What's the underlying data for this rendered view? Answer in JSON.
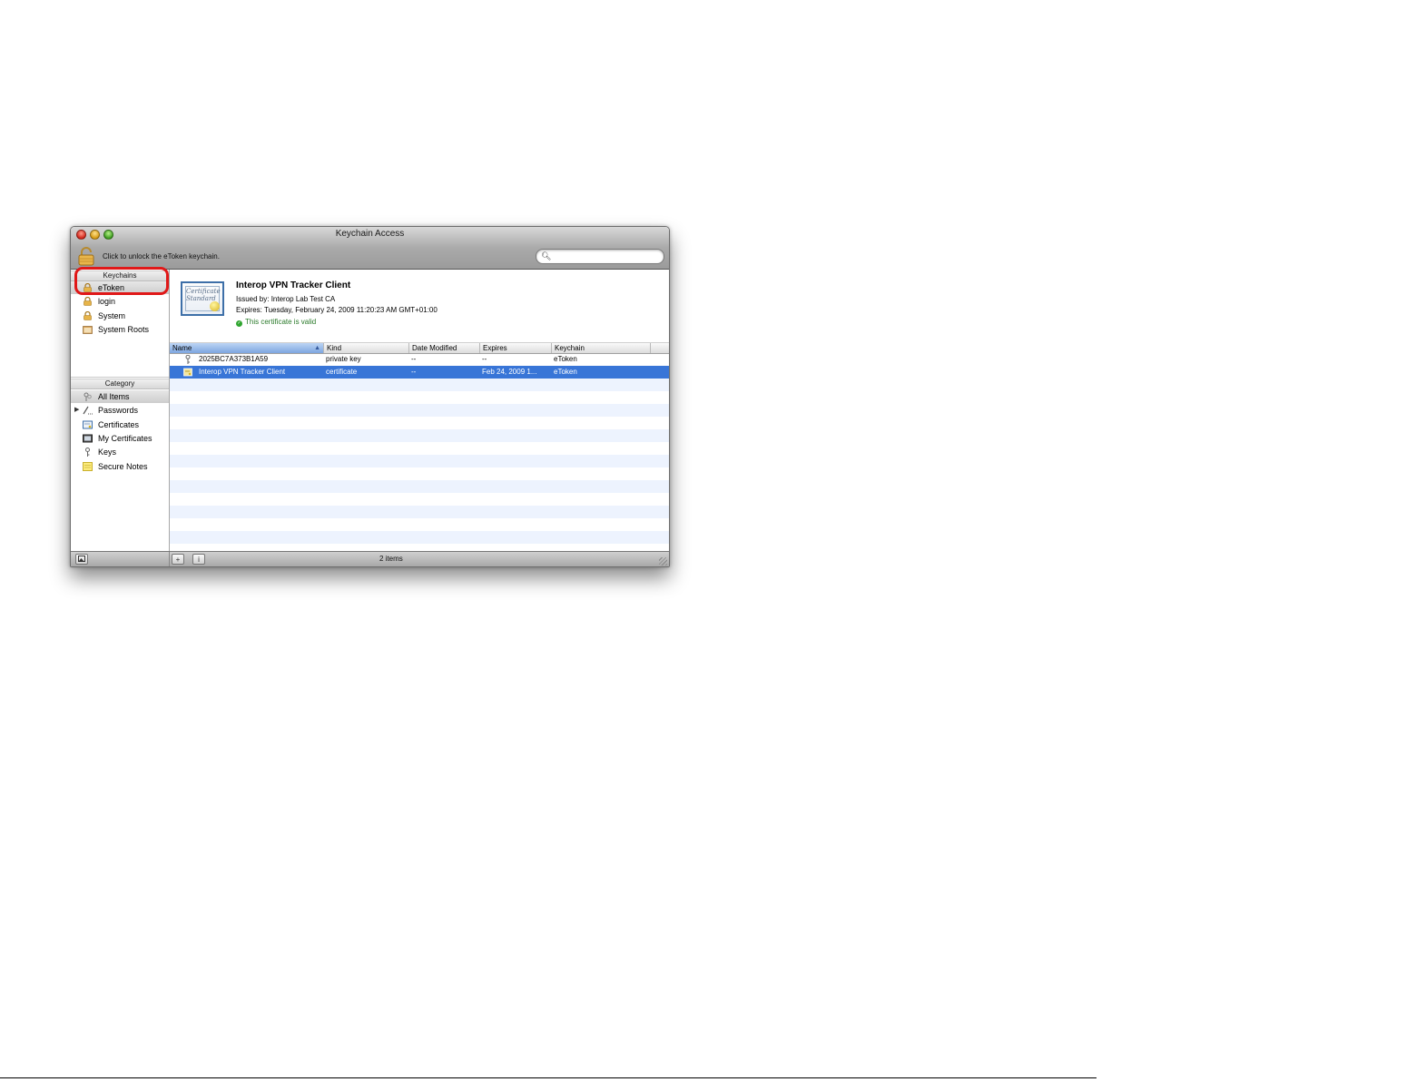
{
  "window": {
    "title": "Keychain Access",
    "lock_message": "Click to unlock the eToken keychain."
  },
  "search": {
    "placeholder": ""
  },
  "sidebar": {
    "keychains_header": "Keychains",
    "keychains": [
      {
        "label": "eToken",
        "icon": "lock-icon",
        "selected": true
      },
      {
        "label": "login",
        "icon": "lock-icon",
        "selected": false
      },
      {
        "label": "System",
        "icon": "lock-icon",
        "selected": false
      },
      {
        "label": "System Roots",
        "icon": "folder-icon",
        "selected": false
      }
    ],
    "category_header": "Category",
    "categories": [
      {
        "label": "All Items",
        "icon": "all-items-icon",
        "selected": true
      },
      {
        "label": "Passwords",
        "icon": "passwords-icon",
        "selected": false,
        "expandable": true
      },
      {
        "label": "Certificates",
        "icon": "certificate-icon",
        "selected": false
      },
      {
        "label": "My Certificates",
        "icon": "my-certificate-icon",
        "selected": false
      },
      {
        "label": "Keys",
        "icon": "key-icon",
        "selected": false
      },
      {
        "label": "Secure Notes",
        "icon": "note-icon",
        "selected": false
      }
    ]
  },
  "detail": {
    "name": "Interop VPN Tracker Client",
    "issued_by": "Issued by: Interop Lab Test CA",
    "expires": "Expires: Tuesday, February 24, 2009 11:20:23 AM GMT+01:00",
    "validity": "This certificate is valid",
    "icon_script": "Certificate Standard"
  },
  "table": {
    "columns": [
      "Name",
      "Kind",
      "Date Modified",
      "Expires",
      "Keychain"
    ],
    "sorted_column": "Name",
    "rows": [
      {
        "icon": "key-icon",
        "name": "2025BC7A373B1A59",
        "kind": "private key",
        "modified": "--",
        "expires": "--",
        "keychain": "eToken",
        "selected": false
      },
      {
        "icon": "certificate-icon",
        "name": "Interop VPN Tracker Client",
        "kind": "certificate",
        "modified": "--",
        "expires": "Feb 24, 2009 1...",
        "keychain": "eToken",
        "selected": true
      }
    ]
  },
  "statusbar": {
    "add_label": "+",
    "info_label": "i",
    "item_count": "2 items"
  },
  "colors": {
    "selection": "#3875d7",
    "stripe": "#edf3fe",
    "annotation_ring": "#e01818"
  }
}
